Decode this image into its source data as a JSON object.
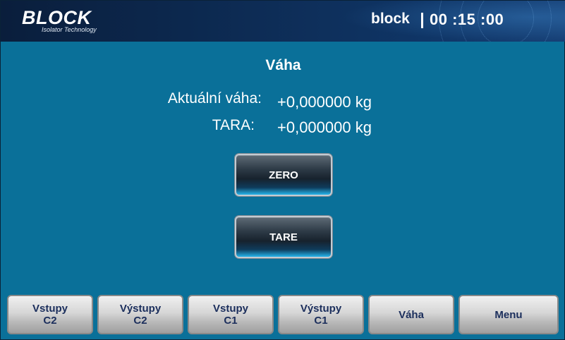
{
  "header": {
    "logo_text": "BLOCK",
    "logo_subtitle": "Isolator Technology",
    "user": "block",
    "time": "00 :15 :00"
  },
  "weight": {
    "title": "Váha",
    "actual_label": "Aktuální váha:",
    "actual_value": "+0,000000 kg",
    "tare_label": "TARA:",
    "tare_value": "+0,000000 kg"
  },
  "buttons": {
    "zero": "ZERO",
    "tare": "TARE"
  },
  "nav": [
    {
      "label": "Vstupy\nC2"
    },
    {
      "label": "Výstupy\nC2"
    },
    {
      "label": "Vstupy\nC1"
    },
    {
      "label": "Výstupy\nC1"
    },
    {
      "label": "Váha"
    },
    {
      "label": "Menu"
    }
  ],
  "colors": {
    "background": "#0a7099",
    "header": "#0d2c55",
    "nav_text": "#1b2e5c"
  }
}
